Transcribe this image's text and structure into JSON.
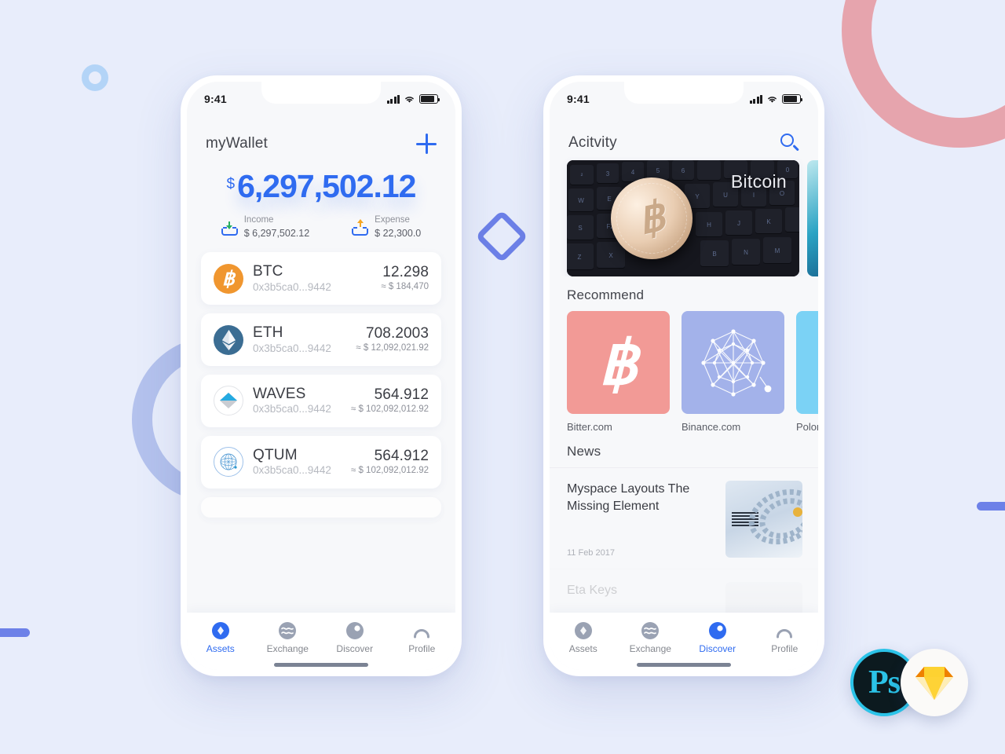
{
  "canvas": {
    "background": "#e8edfb"
  },
  "decor": {
    "pink_ring_color": "#e6a4ad",
    "blue_ring_color": "#b4c2ed",
    "small_circle_color": "#b3d4f7",
    "diamond_color": "#6d81e8",
    "bar_color": "#6d81e8"
  },
  "theme": {
    "accent": "#2f6bf0",
    "tab_active": "#2f6bf0",
    "tab_inactive": "#85888f"
  },
  "phone1": {
    "status": {
      "time": "9:41",
      "signal_icon": "cellular-bars-icon",
      "wifi_icon": "wifi-icon",
      "battery_icon": "battery-icon"
    },
    "header": {
      "title": "myWallet",
      "add_icon": "plus-icon"
    },
    "balance": {
      "currency": "$",
      "amount": "6,297,502.12"
    },
    "stats": [
      {
        "label": "Income",
        "value": "$ 6,297,502.12",
        "icon": "download-tray-icon",
        "arrow_color": "#27ae60"
      },
      {
        "label": "Expense",
        "value": "$ 22,300.0",
        "icon": "upload-tray-icon",
        "arrow_color": "#f5a623"
      }
    ],
    "assets": [
      {
        "symbol": "BTC",
        "address": "0x3b5ca0...9442",
        "amount": "12.298",
        "usd": "≈ $ 184,470",
        "icon": "bitcoin-coin-icon",
        "color": "#f0962f"
      },
      {
        "symbol": "ETH",
        "address": "0x3b5ca0...9442",
        "amount": "708.2003",
        "usd": "≈ $ 12,092,021.92",
        "icon": "ethereum-coin-icon",
        "color": "#3b6d93"
      },
      {
        "symbol": "WAVES",
        "address": "0x3b5ca0...9442",
        "amount": "564.912",
        "usd": "≈ $ 102,092,012.92",
        "icon": "waves-coin-icon",
        "color": "#25aae1"
      },
      {
        "symbol": "QTUM",
        "address": "0x3b5ca0...9442",
        "amount": "564.912",
        "usd": "≈ $ 102,092,012.92",
        "icon": "qtum-coin-icon",
        "color": "#2e9ad0"
      }
    ],
    "tabs": [
      {
        "label": "Assets",
        "icon": "assets-diamond-icon",
        "active": true
      },
      {
        "label": "Exchange",
        "icon": "exchange-wave-icon",
        "active": false
      },
      {
        "label": "Discover",
        "icon": "discover-compass-icon",
        "active": false
      },
      {
        "label": "Profile",
        "icon": "profile-person-icon",
        "active": false
      }
    ]
  },
  "phone2": {
    "status": {
      "time": "9:41",
      "signal_icon": "cellular-bars-icon",
      "wifi_icon": "wifi-icon",
      "battery_icon": "battery-icon"
    },
    "header": {
      "title": "Acitvity",
      "search_icon": "search-icon"
    },
    "hero": {
      "label": "Bitcoin",
      "image": "bitcoin-coin-on-keyboard-photo"
    },
    "sections": {
      "recommend": "Recommend",
      "news": "News"
    },
    "recommend": [
      {
        "name": "Bitter.com",
        "icon": "bitcoin-symbol-icon",
        "color": "#f29a96"
      },
      {
        "name": "Binance.com",
        "icon": "network-graph-icon",
        "color": "#a3b2ea"
      },
      {
        "name": "Poloni",
        "icon": "sparkle-icon",
        "color": "#7bd2f5"
      }
    ],
    "news": [
      {
        "title": "Myspace Layouts The Missing Element",
        "date": "11 Feb 2017",
        "thumb": "ibm-server-photo"
      },
      {
        "title": "Eta Keys",
        "date": "",
        "thumb": "portrait-photo"
      }
    ],
    "tabs": [
      {
        "label": "Assets",
        "icon": "assets-diamond-icon",
        "active": false
      },
      {
        "label": "Exchange",
        "icon": "exchange-wave-icon",
        "active": false
      },
      {
        "label": "Discover",
        "icon": "discover-compass-icon",
        "active": true
      },
      {
        "label": "Profile",
        "icon": "profile-person-icon",
        "active": false
      }
    ]
  },
  "badges": [
    {
      "name": "Photoshop",
      "label": "Ps",
      "icon": "photoshop-icon"
    },
    {
      "name": "Sketch",
      "label": "",
      "icon": "sketch-diamond-icon"
    }
  ]
}
